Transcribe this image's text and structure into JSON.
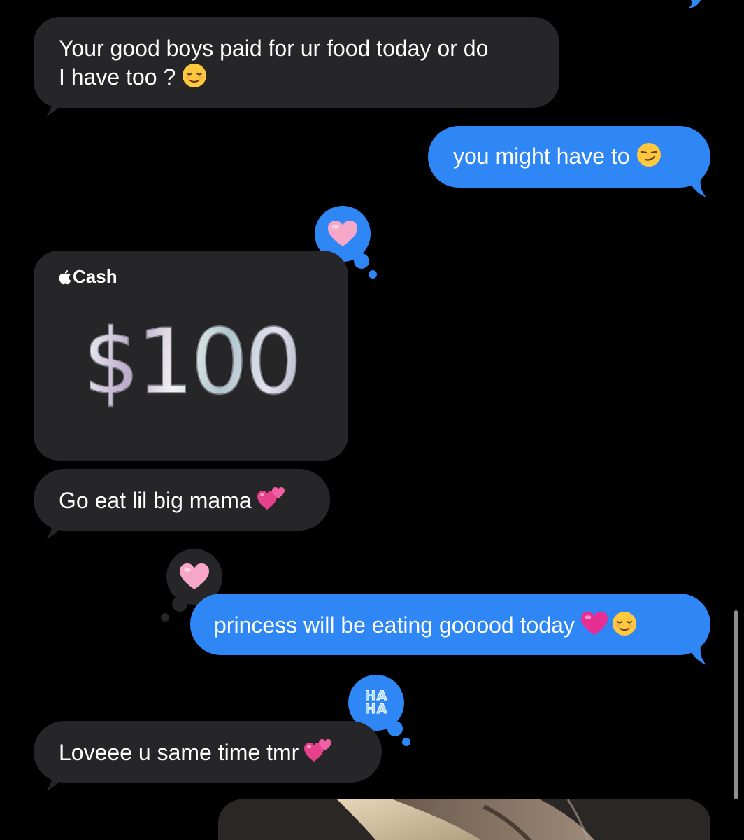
{
  "conversation": {
    "messages": [
      {
        "sender": "them",
        "text_line1": "Your good boys paid for ur food today or do",
        "text_line2": "I have too ?",
        "emoji": "relieved-face"
      },
      {
        "sender": "me",
        "text": "you might have to",
        "emoji": "smirking-face"
      },
      {
        "sender": "them",
        "type": "apple-cash",
        "cash_label": "Cash",
        "amount": "$100",
        "tapback": "heart"
      },
      {
        "sender": "them",
        "text": "Go eat lil big mama",
        "emoji": "two-hearts"
      },
      {
        "sender": "me",
        "text": "princess will be eating gooood today",
        "emoji": "pink-heart + relieved-face",
        "tapback": "heart"
      },
      {
        "sender": "them",
        "text": "Loveee u same time tmr",
        "emoji": "two-hearts",
        "tapback": "haha"
      },
      {
        "sender": "me",
        "type": "photo"
      }
    ],
    "tapback_haha_line1": "HA",
    "tapback_haha_line2": "HA"
  },
  "colors": {
    "background": "#000000",
    "received_bubble": "#262628",
    "sent_bubble": "#2f87f6",
    "heart": "#f7a8c8",
    "haha_text": "#9fd3ff"
  }
}
